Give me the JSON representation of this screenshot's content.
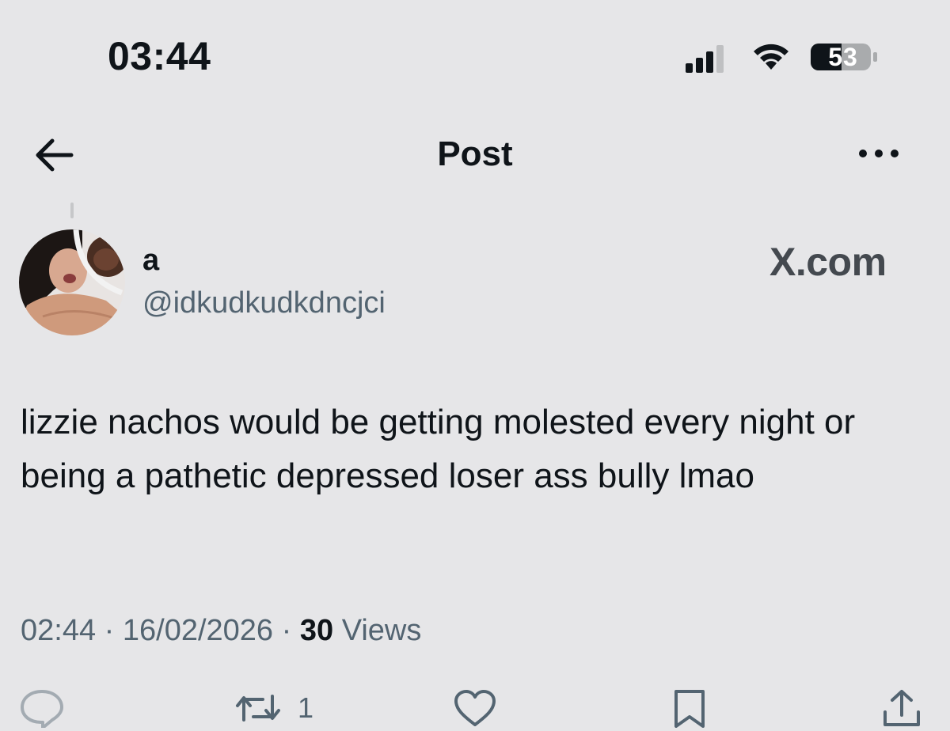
{
  "status_bar": {
    "time": "03:44",
    "battery_level": "53",
    "icons": [
      "cellular-signal-icon",
      "wifi-icon",
      "battery-icon"
    ]
  },
  "header": {
    "title": "Post",
    "back_icon": "arrow-left-icon",
    "more_icon": "more-horizontal-icon"
  },
  "post": {
    "author": {
      "display_name": "a",
      "handle": "@idkudkudkdncjci"
    },
    "watermark": "X.com",
    "text": "lizzie nachos would be getting molested every night or being a pathetic depressed loser ass bully lmao",
    "time": "02:44",
    "date": "16/02/2026",
    "views_count": "30",
    "views_label": "Views",
    "separator": "·"
  },
  "actions": {
    "reply_icon": "reply-icon",
    "repost_icon": "repost-icon",
    "repost_count": "1",
    "like_icon": "heart-icon",
    "bookmark_icon": "bookmark-icon",
    "share_icon": "share-icon"
  },
  "colors": {
    "background": "#e6e6e8",
    "text_primary": "#0f1419",
    "text_secondary": "#536471",
    "icon": "#536471"
  }
}
